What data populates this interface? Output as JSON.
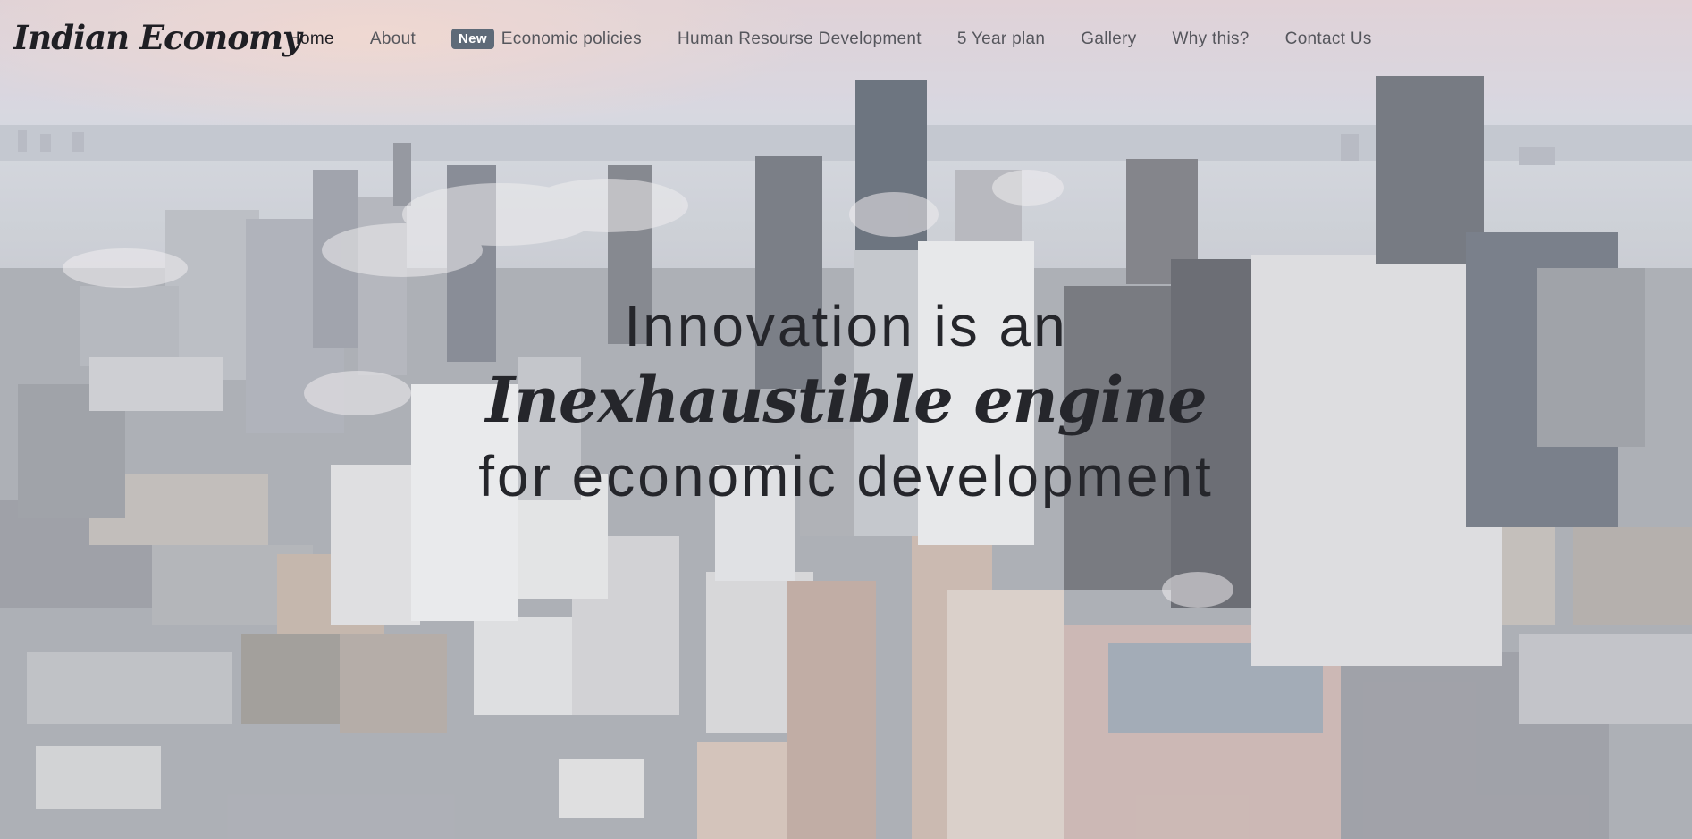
{
  "brand": "Indian Economy",
  "nav": {
    "items": [
      {
        "label": "Home",
        "active": true
      },
      {
        "label": "About"
      },
      {
        "label": "Economic policies",
        "badge": "New"
      },
      {
        "label": "Human Resourse Development"
      },
      {
        "label": "5 Year plan"
      },
      {
        "label": "Gallery"
      },
      {
        "label": "Why this?"
      },
      {
        "label": "Contact Us"
      }
    ]
  },
  "hero": {
    "line1": "Innovation is an",
    "line2": "Inexhaustible engine",
    "line3": "for economic development"
  },
  "background": {
    "subject": "city-skyline-aerial-image",
    "colors": {
      "sky_top": "#d9c9cf",
      "haze": "#c7cbd3",
      "ground": "#7f8187",
      "text": "#25262b",
      "badge": "#5e6a78"
    }
  }
}
